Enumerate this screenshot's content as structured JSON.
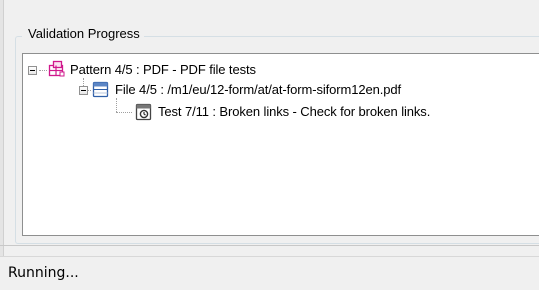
{
  "panel": {
    "title": "Validation Progress"
  },
  "tree": {
    "nodes": [
      {
        "label": "Pattern 4/5 : PDF - PDF file tests",
        "icon": "pattern-icon"
      },
      {
        "label": "File 4/5 : /m1/eu/12-form/at/at-form-siform12en.pdf",
        "icon": "file-icon"
      },
      {
        "label": "Test 7/11 : Broken links - Check for broken links.",
        "icon": "test-icon"
      }
    ]
  },
  "status": {
    "text": "Running..."
  },
  "colors": {
    "pattern_icon": "#d0188c",
    "file_icon": "#2f5fa8",
    "tree_border": "#8e8f8f"
  }
}
